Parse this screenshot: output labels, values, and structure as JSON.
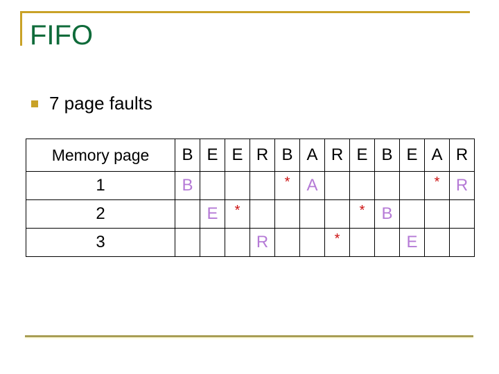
{
  "slide": {
    "title": "FIFO",
    "bullets": [
      {
        "text": "7 page faults"
      }
    ],
    "colors": {
      "accent": "#c9a227",
      "title": "#0f6b3a",
      "loaded_page": "#b57ad6",
      "fault_marker": "#cc1111"
    }
  },
  "table": {
    "header_label": "Memory page",
    "reference_string": [
      "B",
      "E",
      "E",
      "R",
      "B",
      "A",
      "R",
      "E",
      "B",
      "E",
      "A",
      "R"
    ],
    "rows": [
      {
        "label": "1",
        "cells": [
          {
            "text": "B",
            "kind": "loaded"
          },
          {
            "text": "",
            "kind": ""
          },
          {
            "text": "",
            "kind": ""
          },
          {
            "text": "",
            "kind": ""
          },
          {
            "text": "*",
            "kind": "star"
          },
          {
            "text": "A",
            "kind": "loaded"
          },
          {
            "text": "",
            "kind": ""
          },
          {
            "text": "",
            "kind": ""
          },
          {
            "text": "",
            "kind": ""
          },
          {
            "text": "",
            "kind": ""
          },
          {
            "text": "*",
            "kind": "star"
          },
          {
            "text": "R",
            "kind": "loaded"
          }
        ]
      },
      {
        "label": "2",
        "cells": [
          {
            "text": "",
            "kind": ""
          },
          {
            "text": "E",
            "kind": "loaded"
          },
          {
            "text": "*",
            "kind": "star"
          },
          {
            "text": "",
            "kind": ""
          },
          {
            "text": "",
            "kind": ""
          },
          {
            "text": "",
            "kind": ""
          },
          {
            "text": "",
            "kind": ""
          },
          {
            "text": "*",
            "kind": "star"
          },
          {
            "text": "B",
            "kind": "loaded"
          },
          {
            "text": "",
            "kind": ""
          },
          {
            "text": "",
            "kind": ""
          },
          {
            "text": "",
            "kind": ""
          }
        ]
      },
      {
        "label": "3",
        "cells": [
          {
            "text": "",
            "kind": ""
          },
          {
            "text": "",
            "kind": ""
          },
          {
            "text": "",
            "kind": ""
          },
          {
            "text": "R",
            "kind": "loaded"
          },
          {
            "text": "",
            "kind": ""
          },
          {
            "text": "",
            "kind": ""
          },
          {
            "text": "*",
            "kind": "star"
          },
          {
            "text": "",
            "kind": ""
          },
          {
            "text": "",
            "kind": ""
          },
          {
            "text": "E",
            "kind": "loaded"
          },
          {
            "text": "",
            "kind": ""
          },
          {
            "text": "",
            "kind": ""
          }
        ]
      }
    ]
  }
}
